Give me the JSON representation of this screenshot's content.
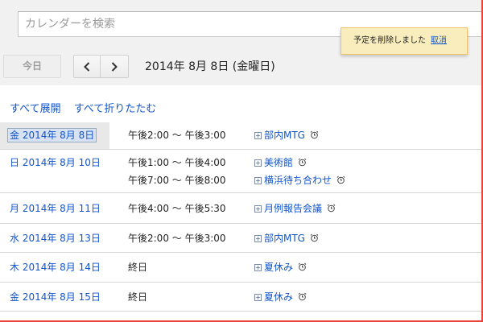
{
  "search": {
    "placeholder": "カレンダーを検索"
  },
  "toast": {
    "message": "予定を削除しました",
    "undo_label": "取消"
  },
  "toolbar": {
    "today_label": "今日",
    "current_date": "2014年 8月 8日 (金曜日)"
  },
  "links": {
    "expand_all": "すべて展開",
    "collapse_all": "すべて折りたたむ"
  },
  "agenda": [
    {
      "date": "金 2014年 8月 8日",
      "events": [
        {
          "time": "午後2:00 ～ 午後3:00",
          "title": "部内MTG"
        }
      ]
    },
    {
      "date": "日 2014年 8月 10日",
      "events": [
        {
          "time": "午後1:00 ～ 午後4:00",
          "title": "美術館"
        },
        {
          "time": "午後7:00 ～ 午後8:00",
          "title": "横浜待ち合わせ"
        }
      ]
    },
    {
      "date": "月 2014年 8月 11日",
      "events": [
        {
          "time": "午後4:00 ～ 午後5:30",
          "title": "月例報告会議"
        }
      ]
    },
    {
      "date": "水 2014年 8月 13日",
      "events": [
        {
          "time": "午後2:00 ～ 午後3:00",
          "title": "部内MTG"
        }
      ]
    },
    {
      "date": "木 2014年 8月 14日",
      "events": [
        {
          "time": "終日",
          "title": "夏休み"
        }
      ]
    },
    {
      "date": "金 2014年 8月 15日",
      "events": [
        {
          "time": "終日",
          "title": "夏休み"
        }
      ]
    }
  ],
  "colors": {
    "link": "#1155cc",
    "toast_bg": "#f9edbe",
    "frame": "#e8443a"
  }
}
